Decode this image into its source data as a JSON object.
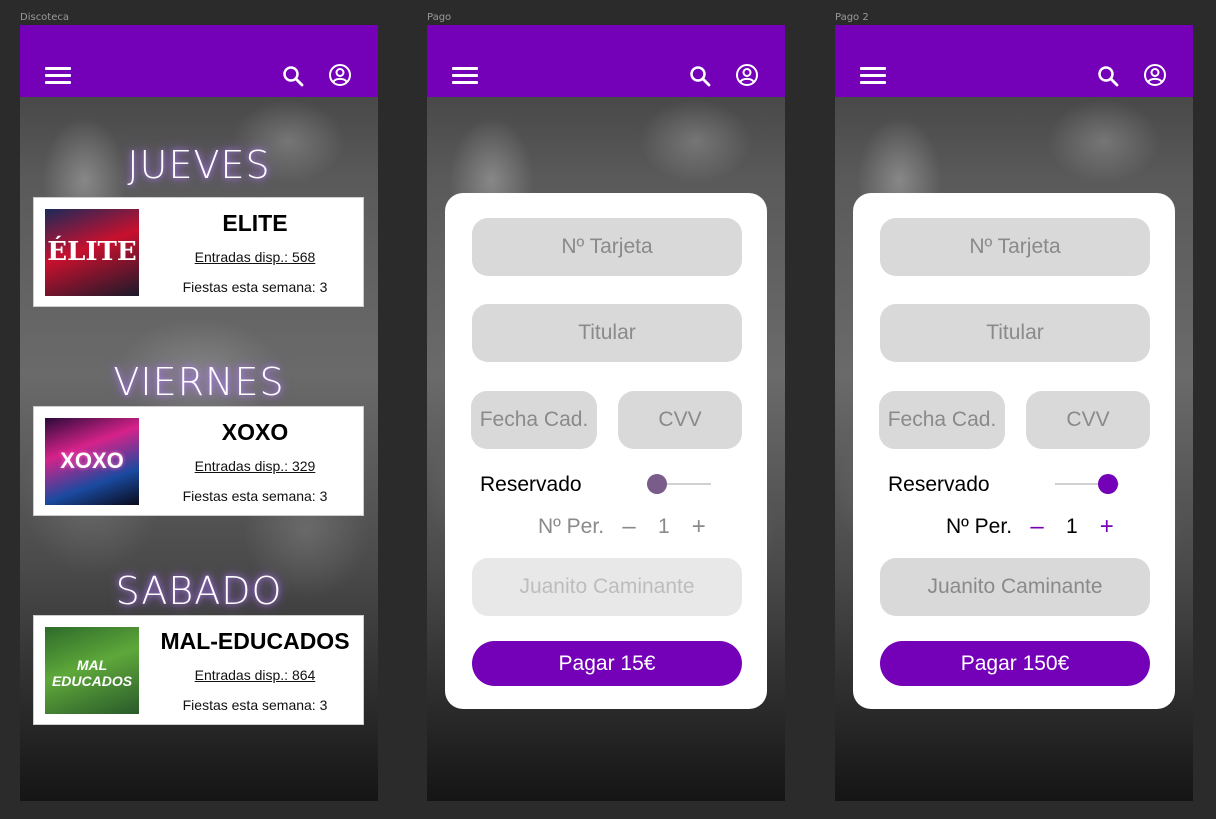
{
  "frames": {
    "discoteca": {
      "label": "Discoteca"
    },
    "pago": {
      "label": "Pago"
    },
    "pago2": {
      "label": "Pago 2"
    }
  },
  "colors": {
    "accent": "#7400b8",
    "field_bg": "#d9d9d9",
    "toggle_off": "#7a5c8a"
  },
  "icons": {
    "menu": "menu-icon",
    "search": "search-icon",
    "account": "account-icon"
  },
  "events": {
    "days": [
      "JUEVES",
      "VIERNES",
      "SABADO"
    ],
    "items": [
      {
        "name": "ELITE",
        "tickets": "Entradas disp.: 568",
        "week": "Fiestas esta semana: 3",
        "poster_text": "ÉLITE"
      },
      {
        "name": "XOXO",
        "tickets": "Entradas disp.: 329",
        "week": "Fiestas esta semana: 3",
        "poster_text": "XOXO"
      },
      {
        "name": "MAL-EDUCADOS",
        "tickets": "Entradas disp.: 864",
        "week": "Fiestas esta semana: 3",
        "poster_text": "MAL EDUCADOS"
      }
    ]
  },
  "payment": {
    "card_number_placeholder": "Nº Tarjeta",
    "holder_placeholder": "Titular",
    "expiry_placeholder": "Fecha Cad.",
    "cvv_placeholder": "CVV",
    "reserved_label": "Reservado",
    "persons_label": "Nº Per.",
    "minus": "–",
    "plus": "+",
    "persons_value": "1",
    "name_value": "Juanito Caminante"
  },
  "pago": {
    "reserved": false,
    "pay_label": "Pagar 15€"
  },
  "pago2": {
    "reserved": true,
    "pay_label": "Pagar 150€"
  }
}
